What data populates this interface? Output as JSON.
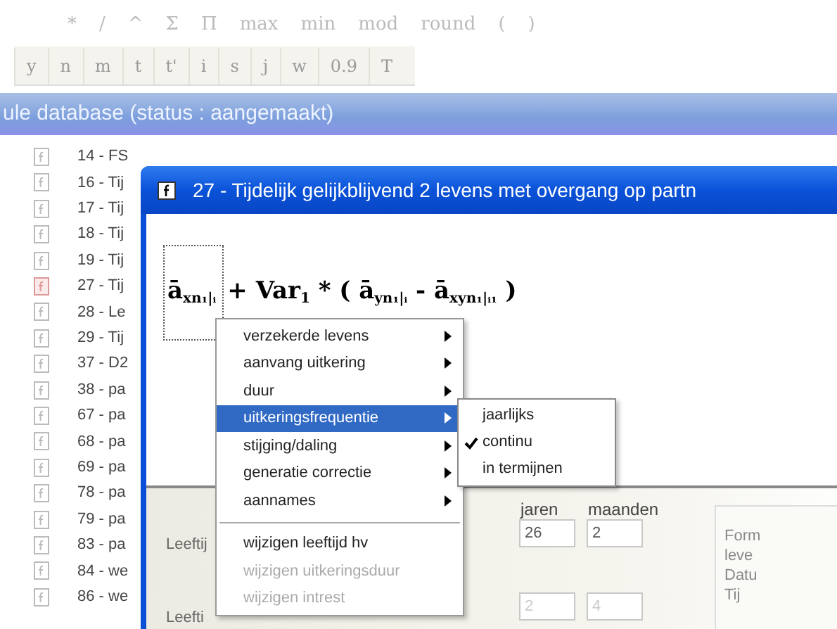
{
  "toolbar_rows": [
    [
      "*",
      "/",
      "^",
      "Σ",
      "Π",
      "max",
      "min",
      "mod",
      "round",
      "(",
      ")"
    ],
    [
      "y",
      "n",
      "m",
      "t",
      "t'",
      "i",
      "s",
      "j",
      "w",
      "0.9",
      "T"
    ]
  ],
  "main_window": {
    "title": "ule database (status : aangemaakt)",
    "rows": [
      {
        "label": "14 - FS",
        "selected": false
      },
      {
        "label": "16 - Tij",
        "selected": false
      },
      {
        "label": "17 - Tij",
        "selected": false
      },
      {
        "label": "18 - Tij",
        "selected": false
      },
      {
        "label": "19 - Tij",
        "selected": false
      },
      {
        "label": "27 - Tij",
        "selected": true
      },
      {
        "label": "28 - Le",
        "selected": false
      },
      {
        "label": "29 - Tij",
        "selected": false
      },
      {
        "label": "37 - D2",
        "selected": false
      },
      {
        "label": "38 - pa",
        "selected": false
      },
      {
        "label": "67 - pa",
        "selected": false
      },
      {
        "label": "68 - pa",
        "selected": false
      },
      {
        "label": "69 - pa",
        "selected": false
      },
      {
        "label": "78 - pa",
        "selected": false
      },
      {
        "label": "79 - pa",
        "selected": false
      },
      {
        "label": "83 - pa",
        "selected": false
      },
      {
        "label": "84 - we",
        "selected": false
      },
      {
        "label": "86 - we",
        "selected": false
      }
    ]
  },
  "dialog": {
    "title": "27 - Tijdelijk gelijkblijvend 2 levens met overgang op partn",
    "formula_terms": [
      {
        "text": "ā$_{xn₁|ᵢ}$",
        "selected": true
      },
      {
        "text": "+ Var$_{1}$ * ( ā$_{yn₁|ᵢ}$ - ā$_{xyn₁|ᵢ₁}$ )",
        "selected": false
      }
    ],
    "fields": {
      "labels": [
        "Leeftij",
        "Leefti"
      ],
      "columns": [
        "jaren",
        "maanden"
      ],
      "rows": [
        [
          "26",
          "2"
        ],
        [
          "2",
          "4"
        ]
      ]
    },
    "info_lines": [
      "Form",
      "leve",
      "Datu",
      "Tij"
    ]
  },
  "context_menu": {
    "items": [
      {
        "kind": "item",
        "label": "verzekerde levens",
        "submenu": true,
        "selected": false,
        "disabled": false
      },
      {
        "kind": "item",
        "label": "aanvang uitkering",
        "submenu": true,
        "selected": false,
        "disabled": false
      },
      {
        "kind": "item",
        "label": "duur",
        "submenu": true,
        "selected": false,
        "disabled": false
      },
      {
        "kind": "item",
        "label": "uitkeringsfrequentie",
        "submenu": true,
        "selected": true,
        "disabled": false
      },
      {
        "kind": "item",
        "label": "stijging/daling",
        "submenu": true,
        "selected": false,
        "disabled": false
      },
      {
        "kind": "item",
        "label": "generatie correctie",
        "submenu": true,
        "selected": false,
        "disabled": false
      },
      {
        "kind": "item",
        "label": "aannames",
        "submenu": true,
        "selected": false,
        "disabled": false
      },
      {
        "kind": "separator"
      },
      {
        "kind": "item",
        "label": "wijzigen leeftijd hv",
        "submenu": false,
        "selected": false,
        "disabled": false
      },
      {
        "kind": "item",
        "label": "wijzigen uitkeringsduur",
        "submenu": false,
        "selected": false,
        "disabled": true
      },
      {
        "kind": "item",
        "label": "wijzigen intrest",
        "submenu": false,
        "selected": false,
        "disabled": true
      }
    ]
  },
  "submenu": {
    "items": [
      {
        "label": "jaarlijks",
        "checked": false
      },
      {
        "label": "continu",
        "checked": true
      },
      {
        "label": "in termijnen",
        "checked": false
      }
    ]
  }
}
